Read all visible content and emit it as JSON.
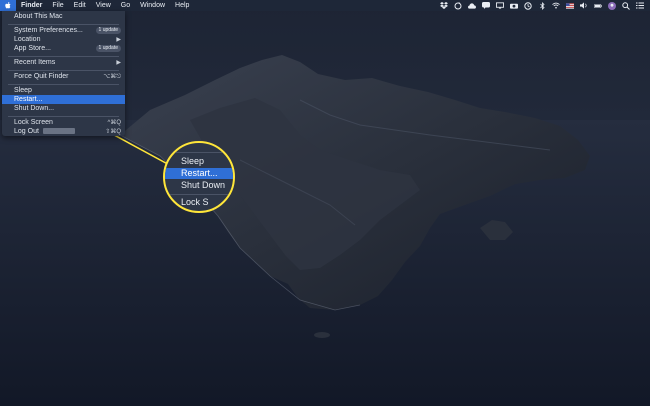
{
  "menubar": {
    "apple_icon": "apple-icon",
    "app_name": "Finder",
    "items": [
      "File",
      "Edit",
      "View",
      "Go",
      "Window",
      "Help"
    ],
    "status_icons": [
      "dropbox-icon",
      "sync-icon",
      "cloud-icon",
      "messages-icon",
      "screen-icon",
      "camera-icon",
      "time-machine-icon",
      "bluetooth-icon",
      "wifi-icon",
      "flag-icon",
      "volume-icon",
      "battery-icon",
      "avatar-icon",
      "search-icon",
      "notification-icon"
    ]
  },
  "apple_menu": {
    "about": "About This Mac",
    "system_preferences": "System Preferences...",
    "system_preferences_badge": "1 update",
    "location": "Location",
    "app_store": "App Store...",
    "app_store_badge": "1 update",
    "recent_items": "Recent Items",
    "force_quit": "Force Quit Finder",
    "force_quit_shortcut": "⌥⌘⎋",
    "sleep": "Sleep",
    "restart": "Restart...",
    "shut_down": "Shut Down...",
    "lock_screen": "Lock Screen",
    "lock_screen_shortcut": "^⌘Q",
    "log_out": "Log Out",
    "log_out_shortcut": "⇧⌘Q"
  },
  "magnifier": {
    "sleep": "Sleep",
    "restart": "Restart...",
    "shut_down": "Shut Down",
    "lock_partial": "Lock S"
  },
  "colors": {
    "highlight": "#2f6fd6",
    "callout": "#ffe63a",
    "menu_bg": "#2d3647",
    "menubar_bg": "#1e2738"
  }
}
